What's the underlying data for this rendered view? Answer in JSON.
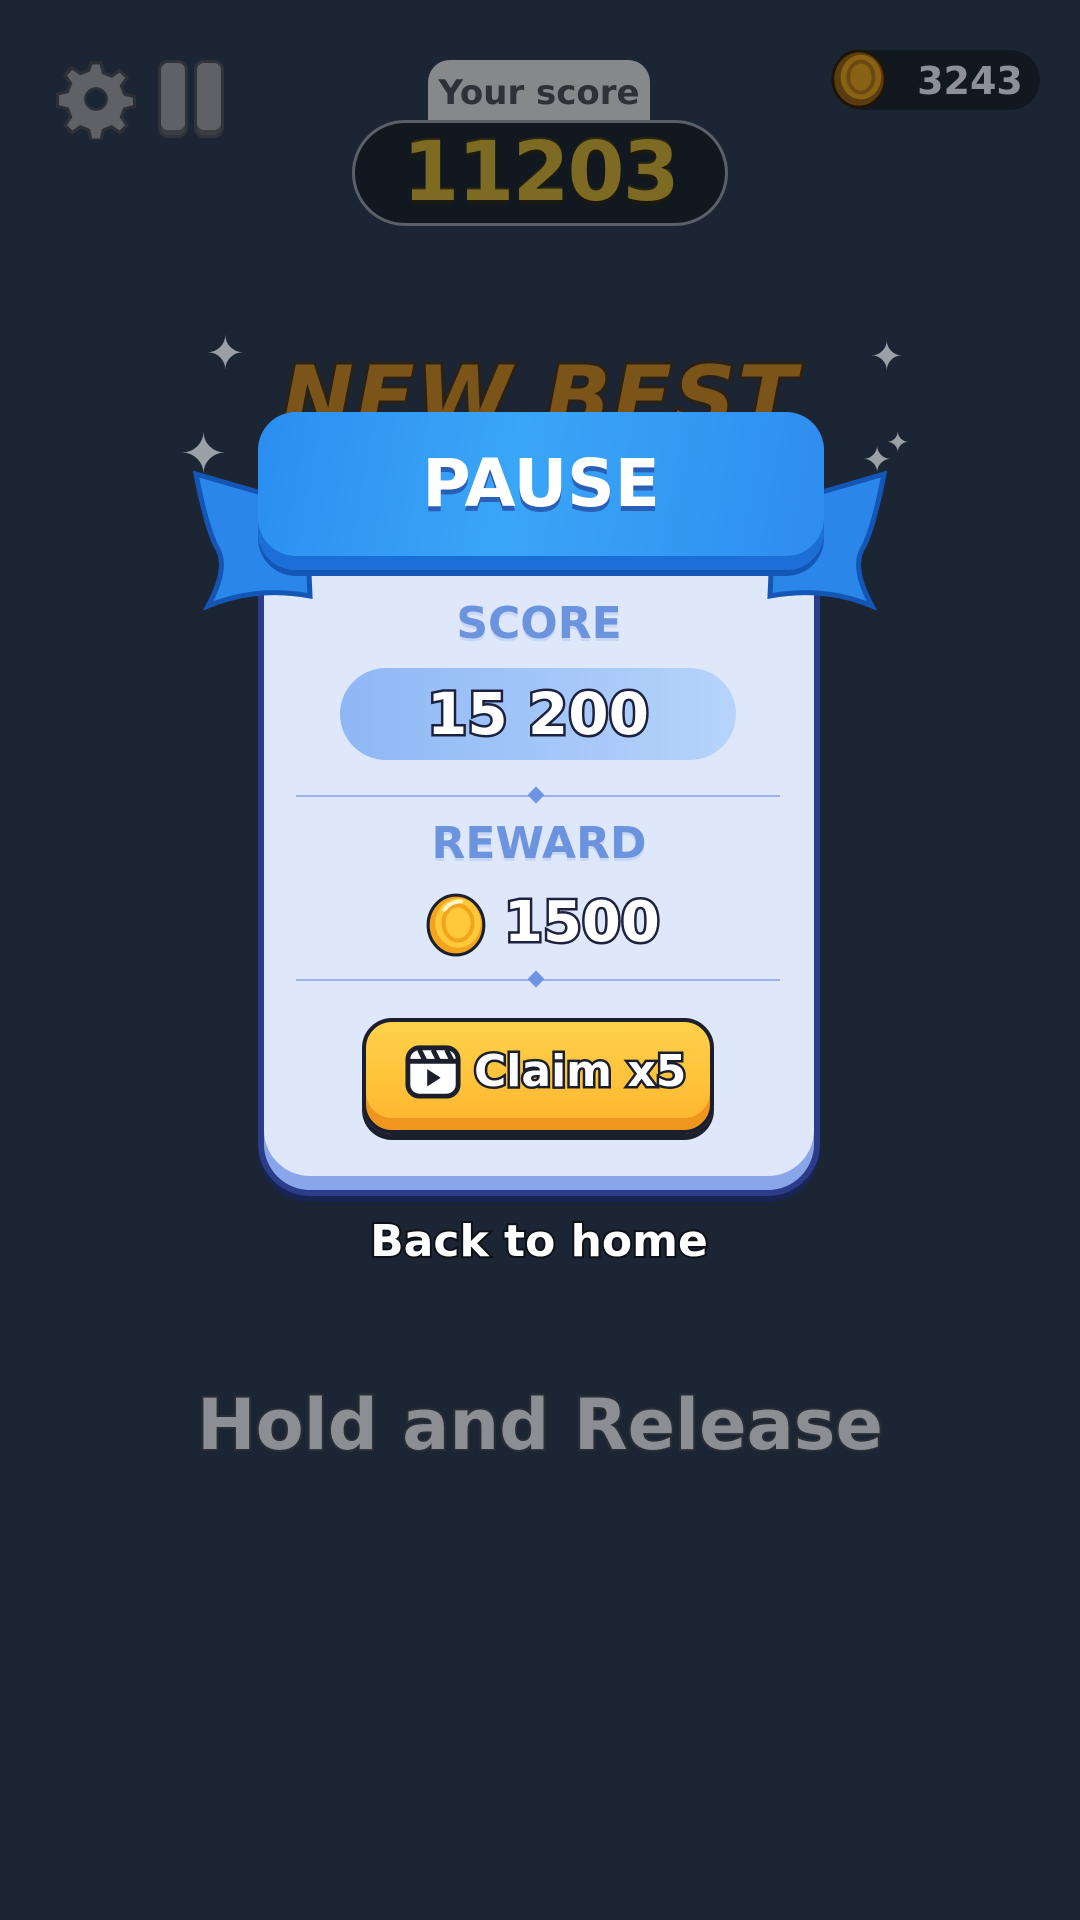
{
  "hud": {
    "settings_icon": "gear-icon",
    "pause_icon": "pause-icon",
    "score_label": "Your score",
    "score_value": "11203",
    "coins": "3243"
  },
  "banner": {
    "text": "NEW BEST SCORE"
  },
  "pause_panel": {
    "title": "PAUSE",
    "score_label": "SCORE",
    "score_value": "15 200",
    "reward_label": "REWARD",
    "reward_value": "1500",
    "claim_label": "Claim x5",
    "claim_icon": "video-play-icon"
  },
  "back_home": "Back to home",
  "hint": "Hold and Release",
  "colors": {
    "background": "#1c2533",
    "panel": "#dfe7fb",
    "ribbon": "#3aa6f8",
    "claim_button": "#ffc03a",
    "label_blue": "#6b93de"
  }
}
